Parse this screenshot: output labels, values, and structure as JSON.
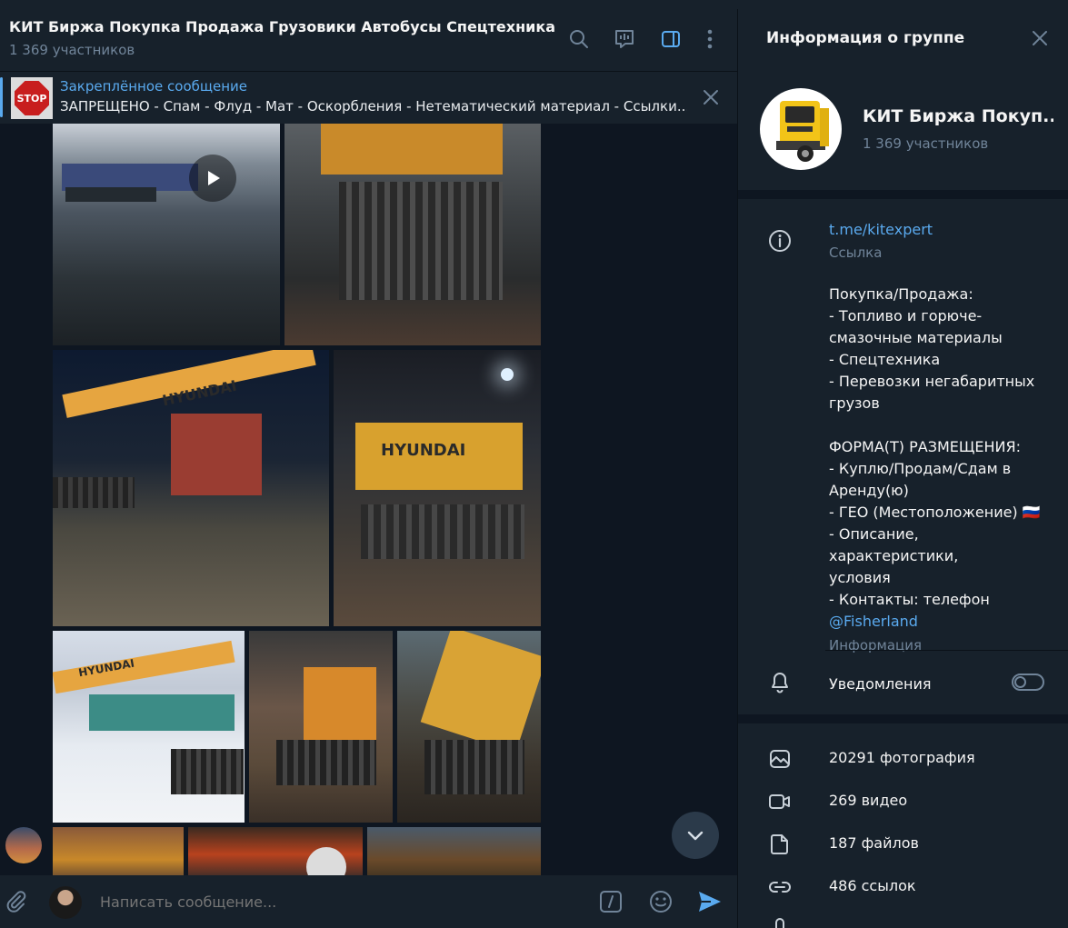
{
  "chat": {
    "title": "КИТ Биржа Покупка Продажа Грузовики Автобусы Спецтехника Самосв...",
    "members": "1 369 участников",
    "icons": [
      "search-icon",
      "live-stream-icon",
      "sidebar-toggle-icon",
      "more-vertical-icon"
    ],
    "pinned": {
      "label": "Закреплённое сообщение",
      "text": "ЗАПРЕЩЕНО - Спам - Флуд - Мат - Оскорбления - Нетематический материал - Ссылки...",
      "thumb_text": "STOP"
    },
    "composer": {
      "placeholder": "Написать сообщение...",
      "icons": [
        "attach-icon",
        "bot-command-icon",
        "emoji-icon",
        "send-icon"
      ]
    },
    "photo_labels": [
      "HYUNDAI",
      "HYUNDAI",
      "HYUNDAI"
    ]
  },
  "info_panel": {
    "title": "Информация о группе",
    "group_name": "КИТ Биржа Покуп...",
    "members": "1 369 участников",
    "link": "t.me/kitexpert",
    "link_label": "Ссылка",
    "description_lines": [
      "Покупка/Продажа:",
      "- Топливо и горюче-",
      "смазочные материалы",
      "- Спецтехника",
      "- Перевозки негабаритных",
      "грузов",
      "",
      "ФОРМА(Т) РАЗМЕЩЕНИЯ:",
      "- Куплю/Продам/Сдам в",
      "Аренду(ю)",
      "- ГЕО (Местоположение) 🇷🇺",
      "- Описание, характеристики,",
      "условия",
      "- Контакты: телефон"
    ],
    "mention": "@Fisherland",
    "description_label": "Информация",
    "notifications_label": "Уведомления",
    "notifications_on": false,
    "media": [
      {
        "icon": "photo-icon",
        "label": "20291 фотография"
      },
      {
        "icon": "video-icon",
        "label": "269 видео"
      },
      {
        "icon": "file-icon",
        "label": "187 файлов"
      },
      {
        "icon": "link-icon",
        "label": "486 ссылок"
      }
    ]
  },
  "colors": {
    "background": "#0e1621",
    "panel": "#17212b",
    "accent": "#5aaaef",
    "muted": "#708499",
    "text": "#f5f5f5"
  }
}
